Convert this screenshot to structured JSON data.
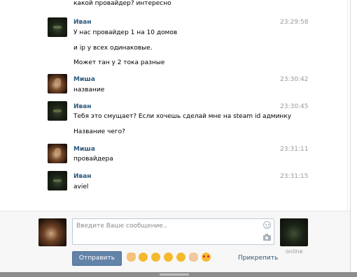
{
  "messages_top": {
    "text": "какой провайдер? интересно"
  },
  "messages": [
    {
      "author": "Иван",
      "time": "23:29:58",
      "lines": [
        "У нас провайдер 1 на 10 домов",
        "и ip у всех одинаковые.",
        "Может тан у 2 тока разные"
      ]
    },
    {
      "author": "Миша",
      "time": "23:30:42",
      "lines": [
        "название"
      ]
    },
    {
      "author": "Иван",
      "time": "23:30:45",
      "lines": [
        "Тебя это смущает? Если хочешь сделай мне на steam id админку",
        "Название чего?"
      ]
    },
    {
      "author": "Миша",
      "time": "23:31:11",
      "lines": [
        "провайдера"
      ]
    },
    {
      "author": "Иван",
      "time": "23:31:15",
      "lines": [
        "aviel"
      ]
    }
  ],
  "compose": {
    "placeholder": "Введите Ваше сообщение..",
    "send_label": "Отправить",
    "attach_label": "Прикрепить",
    "online_label": "online",
    "emoji": [
      "hand-emoji",
      "tongue-emoji",
      "cry-laugh-emoji",
      "shocked-emoji",
      "grin-emoji",
      "punch-emoji",
      "heart-eyes-emoji"
    ]
  },
  "colors": {
    "author": "#2b587a",
    "send_bg": "#6383a8",
    "time": "#999999"
  }
}
